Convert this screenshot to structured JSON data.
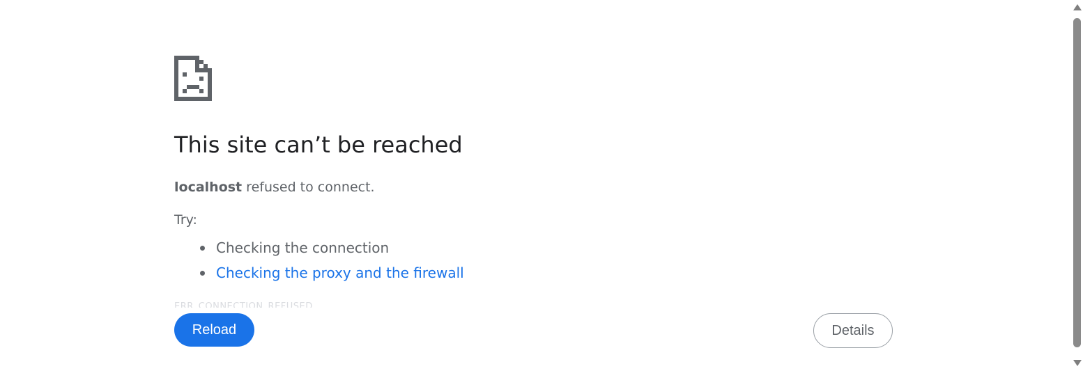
{
  "error": {
    "title": "This site can’t be reached",
    "host": "localhost",
    "message": " refused to connect.",
    "try_label": "Try:",
    "suggestions": [
      {
        "text": "Checking the connection",
        "is_link": false
      },
      {
        "text": "Checking the proxy and the firewall",
        "is_link": true
      }
    ],
    "code": "ERR_CONNECTION_REFUSED"
  },
  "buttons": {
    "reload_label": "Reload",
    "details_label": "Details"
  },
  "colors": {
    "accent": "#1a73e8",
    "text": "#5f6368",
    "title": "#202124"
  },
  "icons": {
    "error_page": "sad-document-icon"
  }
}
